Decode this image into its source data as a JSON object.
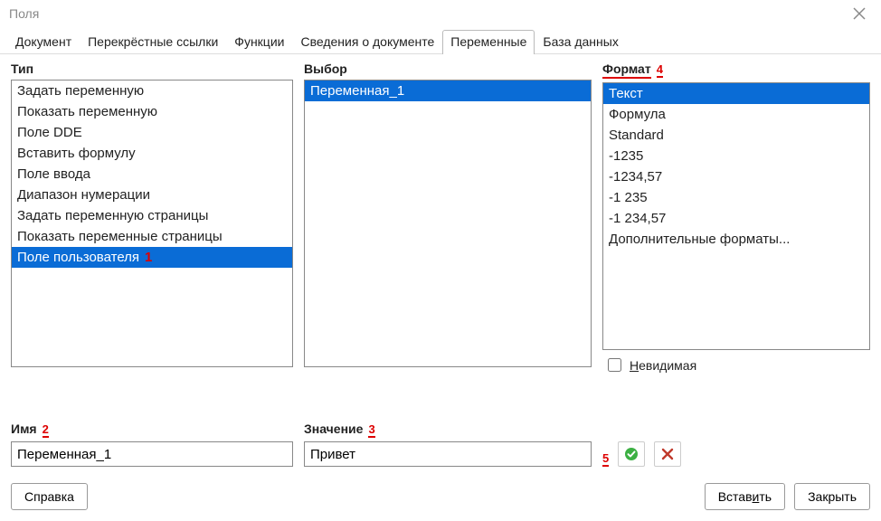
{
  "window": {
    "title": "Поля"
  },
  "tabs": [
    {
      "label": "Документ",
      "active": false
    },
    {
      "label": "Перекрёстные ссылки",
      "active": false
    },
    {
      "label": "Функции",
      "active": false
    },
    {
      "label": "Сведения о документе",
      "active": false
    },
    {
      "label": "Переменные",
      "active": true
    },
    {
      "label": "База данных",
      "active": false
    }
  ],
  "type": {
    "heading": "Тип",
    "items": [
      {
        "label": "Задать переменную",
        "selected": false
      },
      {
        "label": "Показать переменную",
        "selected": false
      },
      {
        "label": "Поле DDE",
        "selected": false
      },
      {
        "label": "Вставить формулу",
        "selected": false
      },
      {
        "label": "Поле ввода",
        "selected": false
      },
      {
        "label": "Диапазон нумерации",
        "selected": false
      },
      {
        "label": "Задать переменную страницы",
        "selected": false
      },
      {
        "label": "Показать переменные страницы",
        "selected": false
      },
      {
        "label": "Поле пользователя",
        "selected": true,
        "mark": "1"
      }
    ]
  },
  "select": {
    "heading": "Выбор",
    "items": [
      {
        "label": "Переменная_1",
        "selected": true
      }
    ]
  },
  "format": {
    "heading": "Формат",
    "mark": "4",
    "items": [
      {
        "label": "Текст",
        "selected": true
      },
      {
        "label": "Формула",
        "selected": false
      },
      {
        "label": "Standard",
        "selected": false
      },
      {
        "label": "-1235",
        "selected": false
      },
      {
        "label": "-1234,57",
        "selected": false
      },
      {
        "label": "-1 235",
        "selected": false
      },
      {
        "label": "-1 234,57",
        "selected": false
      },
      {
        "label": "Дополнительные форматы...",
        "selected": false
      }
    ],
    "invisible_label_pre": "Н",
    "invisible_label_post": "евидимая"
  },
  "name": {
    "heading": "Имя",
    "mark": "2",
    "value": "Переменная_1"
  },
  "value": {
    "heading": "Значение",
    "mark": "3",
    "value": "Привет"
  },
  "icons": {
    "mark": "5"
  },
  "buttons": {
    "help": "Справка",
    "insert_pre": "Встав",
    "insert_u": "и",
    "insert_post": "ть",
    "close": "Закрыть"
  }
}
